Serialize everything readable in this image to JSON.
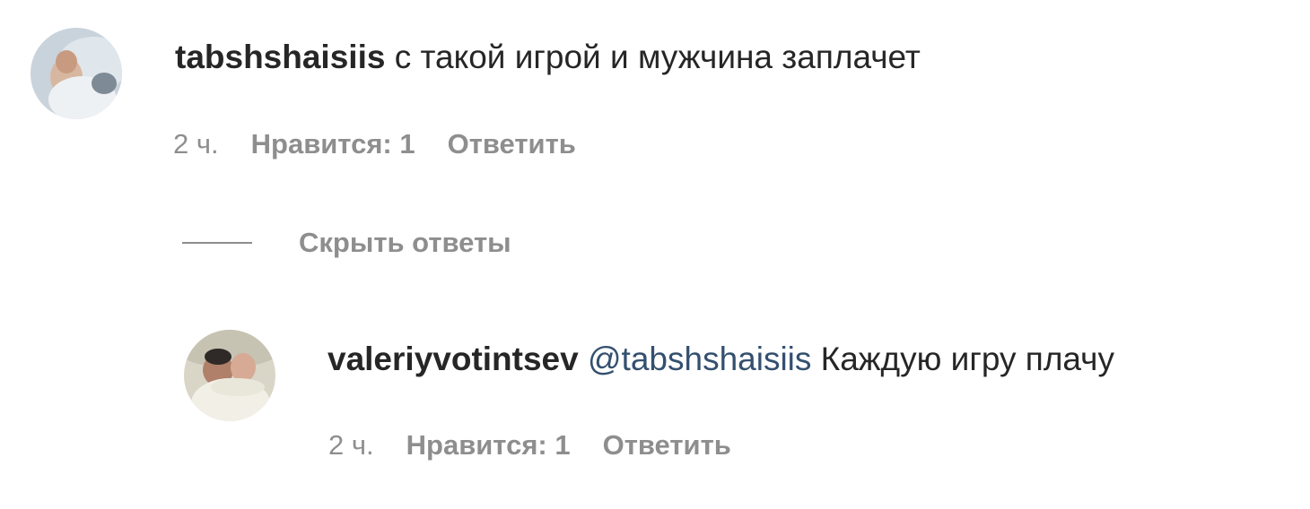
{
  "comment": {
    "username": "tabshshaisiis",
    "text": "с такой игрой и мужчина заплачет",
    "time": "2 ч.",
    "likes": "Нравится: 1",
    "reply": "Ответить"
  },
  "replies_toggle": {
    "label": "Скрыть ответы"
  },
  "reply_comment": {
    "username": "valeriyvotintsev",
    "mention": "@tabshshaisiis",
    "text": "Каждую игру плачу",
    "time": "2 ч.",
    "likes": "Нравится: 1",
    "reply": "Ответить"
  },
  "colors": {
    "text": "#262626",
    "secondary": "#8e8e8e",
    "mention": "#34506f"
  }
}
